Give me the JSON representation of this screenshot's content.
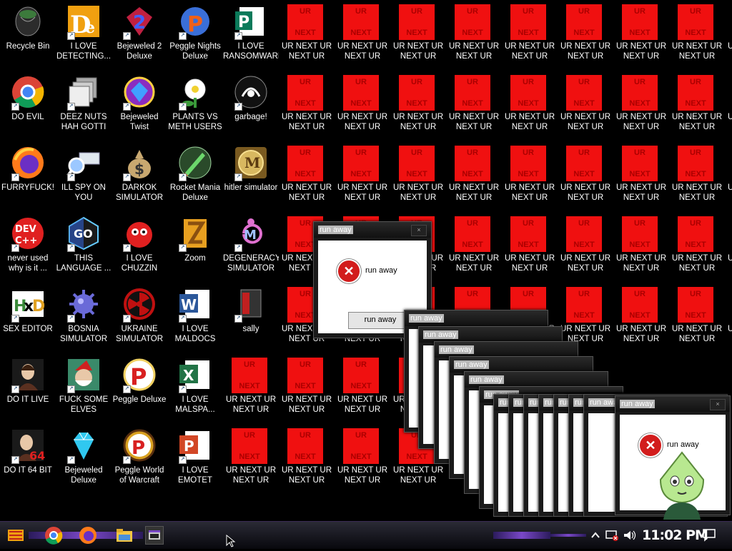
{
  "desktop_icons": [
    {
      "label": "Recycle Bin",
      "icon": "recycle-bin-icon"
    },
    {
      "label": "I LOVE DETECTING...",
      "icon": "detective-app-icon"
    },
    {
      "label": "Bejeweled 2 Deluxe",
      "icon": "bejeweled-2-icon"
    },
    {
      "label": "Peggle Nights Deluxe",
      "icon": "peggle-nights-icon"
    },
    {
      "label": "I LOVE RANSOMWARE",
      "icon": "publisher-icon"
    },
    {
      "label": "DO EVIL",
      "icon": "chrome-icon"
    },
    {
      "label": "DEEZ NUTS HAH GOTTI",
      "icon": "windows-stack-icon"
    },
    {
      "label": "Bejeweled Twist",
      "icon": "bejeweled-twist-icon"
    },
    {
      "label": "PLANTS VS METH USERS",
      "icon": "plants-icon"
    },
    {
      "label": "garbage!",
      "icon": "garbage-logo-icon"
    },
    {
      "label": "FURRYFUCK!",
      "icon": "firefox-icon"
    },
    {
      "label": "ILL SPY ON YOU",
      "icon": "spy-magnifier-icon"
    },
    {
      "label": "DARKOK SIMULATOR",
      "icon": "money-bag-icon"
    },
    {
      "label": "Rocket Mania Deluxe",
      "icon": "rocket-icon"
    },
    {
      "label": "hitler simulator",
      "icon": "medal-icon"
    },
    {
      "label": "never used why is it ...",
      "icon": "devcpp-icon"
    },
    {
      "label": "THIS LANGUAGE ...",
      "icon": "go-language-icon"
    },
    {
      "label": "I LOVE CHUZZIN",
      "icon": "chuzzle-icon"
    },
    {
      "label": "Zoom",
      "icon": "zuma-icon"
    },
    {
      "label": "DEGENERACY SIMULATOR",
      "icon": "cm-logo-icon"
    },
    {
      "label": "SEX EDITOR",
      "icon": "hxd-icon"
    },
    {
      "label": "BOSNIA SIMULATOR",
      "icon": "mine-ball-icon"
    },
    {
      "label": "UKRAINE SIMULATOR",
      "icon": "radiation-icon"
    },
    {
      "label": "I LOVE MALDOCS",
      "icon": "word-icon"
    },
    {
      "label": "sally",
      "icon": "black-box-icon"
    },
    {
      "label": "DO IT LIVE",
      "icon": "portrait-icon"
    },
    {
      "label": "FUCK SOME ELVES",
      "icon": "santa-icon"
    },
    {
      "label": "Peggle Deluxe",
      "icon": "peggle-icon"
    },
    {
      "label": "I LOVE MALSPA...",
      "icon": "excel-icon"
    },
    {
      "label": "DO IT 64 BIT",
      "icon": "portrait-64-icon"
    },
    {
      "label": "Bejeweled Deluxe",
      "icon": "diamond-icon"
    },
    {
      "label": "Peggle World of Warcraft Edition",
      "icon": "peggle-wow-icon"
    },
    {
      "label": "I LOVE EMOTET",
      "icon": "powerpoint-icon"
    }
  ],
  "ur_icon": {
    "label_short": "UR NEXT UR NEXT UR NE...",
    "label_long": "UR NEXT UR NEXT UR NEXT UR",
    "image_top": "UR",
    "image_bottom": "NEXT",
    "color": "#f01010"
  },
  "dialog": {
    "title": "run away",
    "message": "run away",
    "button": "run away",
    "close": "×",
    "error_glyph": "✕"
  },
  "taskbar": {
    "apps": [
      {
        "icon": "start-logo-icon"
      },
      {
        "icon": "chrome-icon"
      },
      {
        "icon": "firefox-icon"
      },
      {
        "icon": "folder-icon"
      },
      {
        "icon": "console-window-icon"
      }
    ],
    "tray": [
      "network-warning-icon",
      "volume-icon"
    ],
    "clock": "11:02 PM",
    "notification_icon": "notification-icon",
    "accent": "#7a48c8"
  }
}
